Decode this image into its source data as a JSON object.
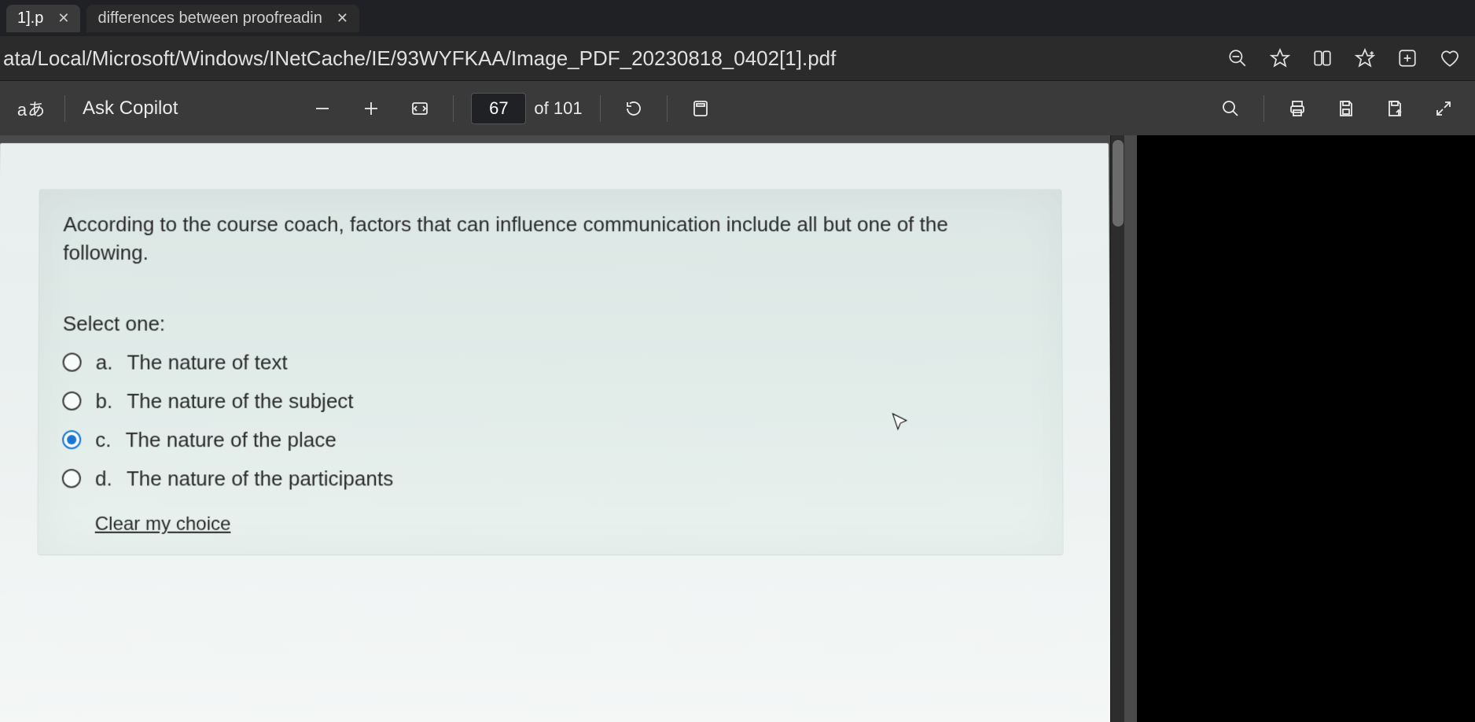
{
  "tabs": {
    "tab1_label": "1].p",
    "tab2_label": "differences between proofreadin"
  },
  "address_bar": {
    "url_text": "ata/Local/Microsoft/Windows/INetCache/IE/93WYFKAA/Image_PDF_20230818_0402[1].pdf"
  },
  "pdf_toolbar": {
    "ask_copilot_label": "Ask Copilot",
    "page_current": "67",
    "page_total_label": "of 101"
  },
  "question": {
    "prompt": "According to the course coach, factors that can influence communication include all but one of the following.",
    "select_one_label": "Select one:",
    "options": [
      {
        "letter": "a.",
        "text": "The nature of text",
        "selected": false
      },
      {
        "letter": "b.",
        "text": "The nature of the subject",
        "selected": false
      },
      {
        "letter": "c.",
        "text": "The nature of the place",
        "selected": true
      },
      {
        "letter": "d.",
        "text": "The nature of the participants",
        "selected": false
      }
    ],
    "clear_choice_label": "Clear my choice"
  }
}
